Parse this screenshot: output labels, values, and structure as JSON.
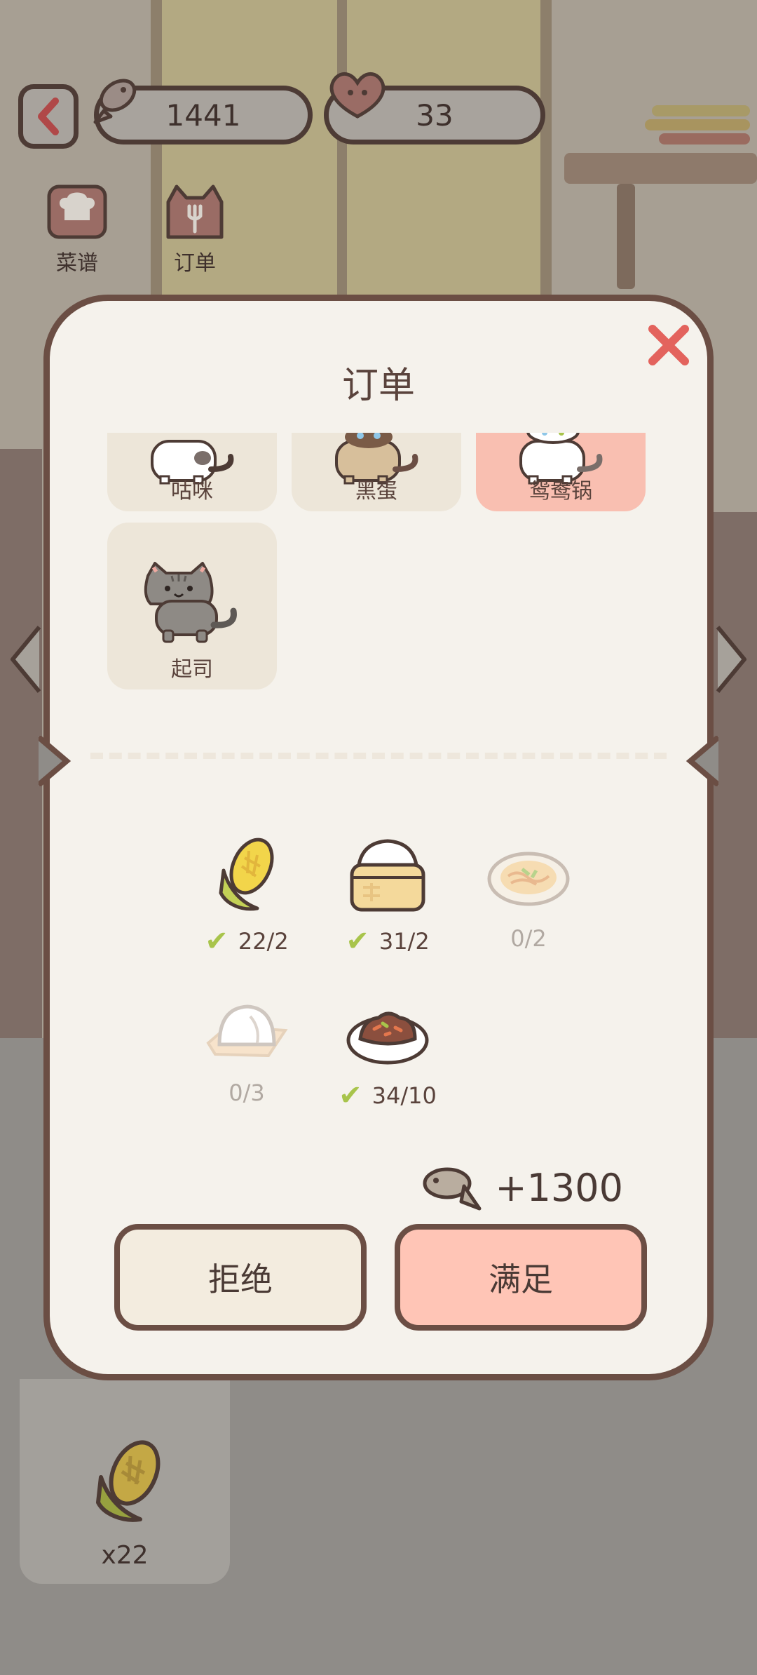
{
  "hud": {
    "fish_count": "1441",
    "heart_count": "33"
  },
  "tabs": [
    {
      "label": "菜谱",
      "icon": "chef-hat-icon"
    },
    {
      "label": "订单",
      "icon": "cat-fork-icon"
    }
  ],
  "modal": {
    "title": "订单",
    "cats": [
      {
        "name": "咕咪",
        "color": "white",
        "selected": false
      },
      {
        "name": "黑蛋",
        "color": "siamese",
        "selected": false
      },
      {
        "name": "鸳鸯锅",
        "color": "white",
        "selected": true
      },
      {
        "name": "起司",
        "color": "grey-tabby",
        "selected": false
      }
    ],
    "requirements": [
      {
        "item": "corn",
        "icon": "corn-icon",
        "quantity": "22/2",
        "fulfilled": true
      },
      {
        "item": "steamed-buns",
        "icon": "steamer-icon",
        "quantity": "31/2",
        "fulfilled": true
      },
      {
        "item": "noodles",
        "icon": "noodle-plate-icon",
        "quantity": "0/2",
        "fulfilled": false
      },
      {
        "item": "dumpling",
        "icon": "dumpling-icon",
        "quantity": "0/3",
        "fulfilled": false
      },
      {
        "item": "braised-meat",
        "icon": "meat-plate-icon",
        "quantity": "34/10",
        "fulfilled": true
      }
    ],
    "reward": "+1300",
    "reject_label": "拒绝",
    "accept_label": "满足"
  },
  "inventory": {
    "item": "corn",
    "count": "x22"
  },
  "colors": {
    "accent_pink": "#ffc5b6",
    "selected_card": "#f9bfb1",
    "close_red": "#e3635d",
    "check_green": "#a8c44b",
    "border_brown": "#6b4e44"
  }
}
